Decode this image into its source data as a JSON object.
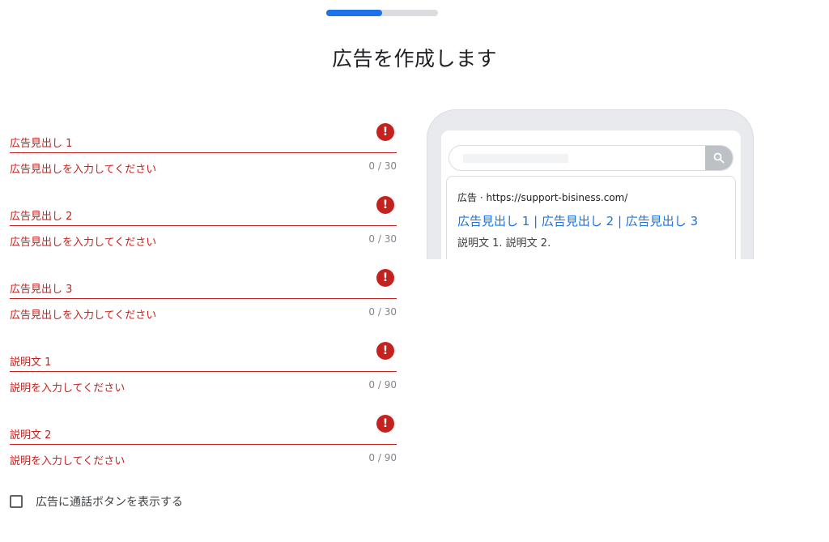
{
  "progress": {
    "value_percent": 50,
    "color": "#1a73e8",
    "track_color": "#dadce0"
  },
  "page_title": "広告を作成します",
  "fields": [
    {
      "label": "広告見出し 1",
      "error": "広告見出しを入力してください",
      "counter": "0 / 30",
      "icon": "error-icon"
    },
    {
      "label": "広告見出し 2",
      "error": "広告見出しを入力してください",
      "counter": "0 / 30",
      "icon": "error-icon"
    },
    {
      "label": "広告見出し 3",
      "error": "広告見出しを入力してください",
      "counter": "0 / 30",
      "icon": "error-icon"
    },
    {
      "label": "説明文 1",
      "error": "説明を入力してください",
      "counter": "0 / 90",
      "icon": "error-icon"
    },
    {
      "label": "説明文 2",
      "error": "説明を入力してください",
      "counter": "0 / 90",
      "icon": "error-icon"
    }
  ],
  "error_icon_glyph": "!",
  "error_color": "#c5221f",
  "call_button_checkbox": {
    "label": "広告に通話ボタンを表示する",
    "checked": false
  },
  "preview": {
    "ad_label": "広告",
    "separator": " · ",
    "url": "https://support-bisiness.com/",
    "headline": "広告見出し 1 | 広告見出し 2 | 広告見出し 3",
    "description": "説明文 1. 説明文 2.",
    "search_icon": "search-icon",
    "headline_color": "#1a73e8"
  }
}
